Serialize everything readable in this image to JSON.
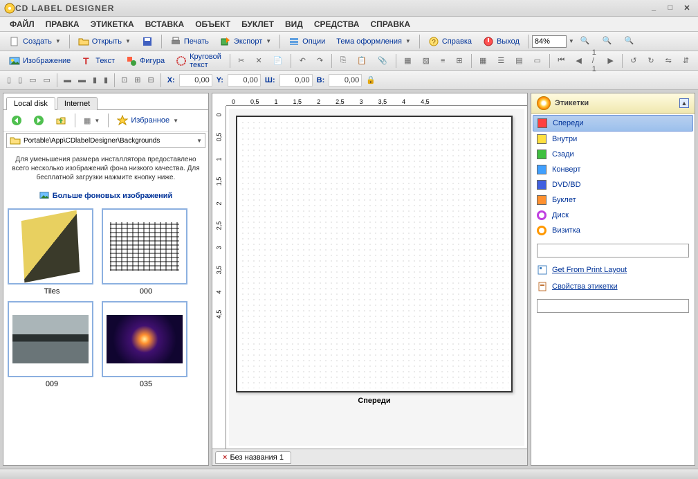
{
  "titlebar": {
    "title": "CD LABEL DESIGNER"
  },
  "menu": [
    "ФАЙЛ",
    "ПРАВКА",
    "ЭТИКЕТКА",
    "ВСТАВКА",
    "ОБЪЕКТ",
    "БУКЛЕТ",
    "ВИД",
    "СРЕДСТВА",
    "СПРАВКА"
  ],
  "toolbar1": {
    "create": "Создать",
    "open": "Открыть",
    "print": "Печать",
    "export": "Экспорт",
    "options": "Опции",
    "theme": "Тема оформления",
    "help": "Справка",
    "exit": "Выход",
    "zoom": "84%"
  },
  "toolbar2": {
    "image": "Изображение",
    "text": "Текст",
    "shape": "Фигура",
    "circtext": "Круговой текст",
    "page": "1 / 1"
  },
  "coords": {
    "x": "0,00",
    "y": "0,00",
    "w": "0,00",
    "h": "0,00",
    "xl": "X:",
    "yl": "Y:",
    "wl": "Ш:",
    "hl": "В:"
  },
  "left": {
    "tabs": [
      "Local disk",
      "Internet"
    ],
    "favorites": "Избранное",
    "path": "Portable\\App\\CDlabelDesigner\\Backgrounds",
    "note": "Для уменьшения размера инсталлятора предоставлено всего несколько изображений фона низкого качества. Для бесплатной загрузки нажмите кнопку ниже.",
    "more": "Больше фоновых изображений",
    "thumbs": [
      {
        "name": "Tiles"
      },
      {
        "name": "000"
      },
      {
        "name": "009"
      },
      {
        "name": "035"
      }
    ]
  },
  "ruler_marks": [
    "0",
    "0,5",
    "1",
    "1,5",
    "2",
    "2,5",
    "3",
    "3,5",
    "4",
    "4,5"
  ],
  "canvas": {
    "caption": "Спереди"
  },
  "doctab": {
    "close": "×",
    "name": "Без названия 1"
  },
  "right": {
    "header": "Этикетки",
    "items": [
      {
        "label": "Спереди",
        "col": "#ff4040",
        "sel": true
      },
      {
        "label": "Внутри",
        "col": "#ffe040"
      },
      {
        "label": "Сзади",
        "col": "#40c040"
      },
      {
        "label": "Конверт",
        "col": "#40a0ff"
      },
      {
        "label": "DVD/BD",
        "col": "#4060e0"
      },
      {
        "label": "Буклет",
        "col": "#ff9030"
      },
      {
        "label": "Диск",
        "col": "#c040e0",
        "shape": "disc"
      },
      {
        "label": "Визитка",
        "col": "#ff9800",
        "shape": "disc"
      }
    ],
    "link1": "Get From Print Layout",
    "link2": "Свойства этикетки"
  }
}
